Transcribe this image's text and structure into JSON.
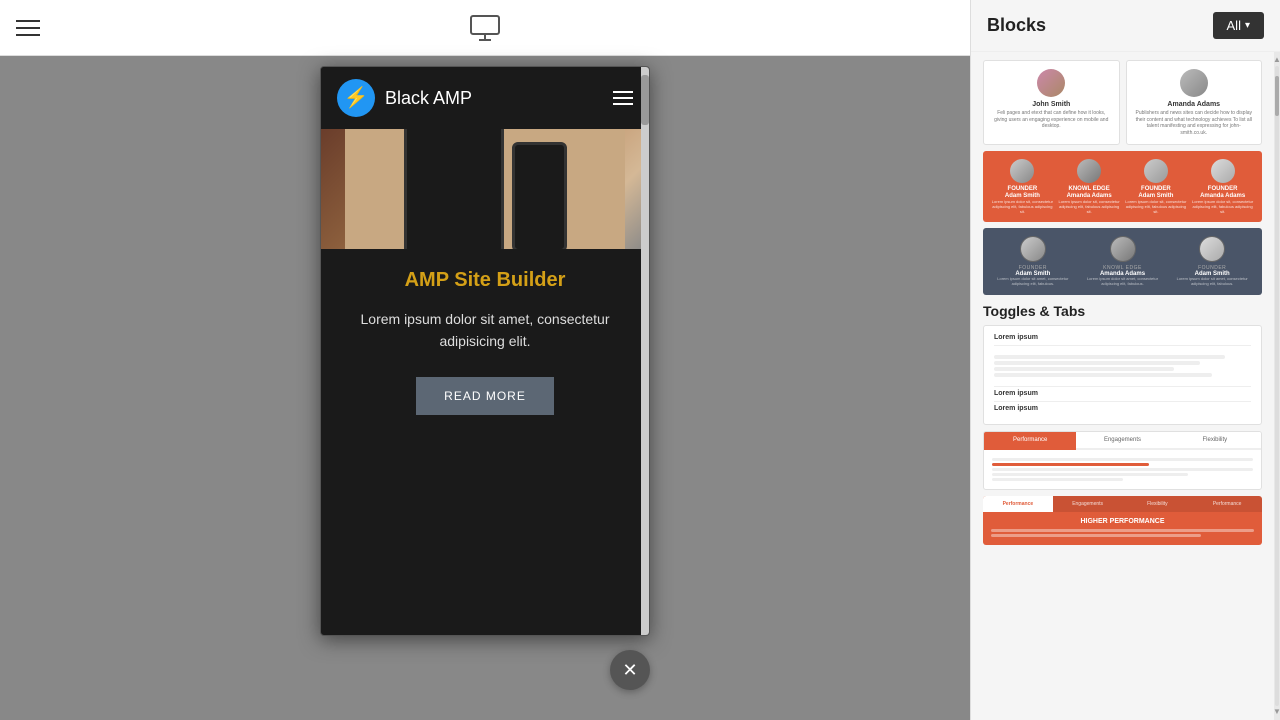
{
  "toolbar": {
    "menu_label": "menu",
    "monitor_label": "monitor"
  },
  "preview": {
    "brand_name": "Black AMP",
    "heading": "AMP Site Builder",
    "body_text": "Lorem ipsum dolor sit amet, consectetur adipisicing elit.",
    "read_more": "READ MORE"
  },
  "blocks_panel": {
    "title": "Blocks",
    "all_button": "All",
    "sections": {
      "team": {
        "cards_2col": [
          {
            "name": "John Smith",
            "desc": "Feli pages and etext that can define how it looks, giving users an engaging experience on mobile and desktop."
          },
          {
            "name": "Amanda Adams",
            "desc": "Publishers and news sites can decide how to display their content and what technology achieves To list all talent manifesting and expressing for john-smith.co.uk."
          }
        ],
        "cards_4col_orange": [
          {
            "name": "Adam Smith",
            "label": "FOUNDER"
          },
          {
            "name": "Amanda Adams",
            "label": "KNOWL EDGE"
          },
          {
            "name": "Adam Smith",
            "label": "FOUNDER"
          },
          {
            "name": "Amanda Adams",
            "label": "FOUNDER"
          }
        ],
        "cards_3col_dark": [
          {
            "name": "Adam Smith",
            "label": "FOUNDER",
            "desc": "Lorem ipsum dolor sit amet, consectetur adipiscing elit, fabulous."
          },
          {
            "name": "Amanda Adams",
            "label": "KNOWL EDGE",
            "desc": "Lorem ipsum dolor sit amet, consectetur adipiscing elit, fabulous."
          },
          {
            "name": "Adam Smith",
            "label": "FOUNDER",
            "desc": "Lorem ipsum dolor sit amet, consectetur adipiscing elit, fabulous."
          }
        ]
      },
      "toggles_tabs": {
        "section_label": "Toggles & Tabs",
        "block1": {
          "item1": "Lorem ipsum",
          "item2": "Lorem ipsum",
          "item3": "Lorem ipsum"
        },
        "block2_tabs": [
          "Performance",
          "Engagements",
          "Flexibility"
        ],
        "block3_tabs": [
          "Performance",
          "Engagements",
          "Flexibility",
          "Performance"
        ],
        "block3_title": "HIGHER PERFORMANCE"
      }
    }
  }
}
